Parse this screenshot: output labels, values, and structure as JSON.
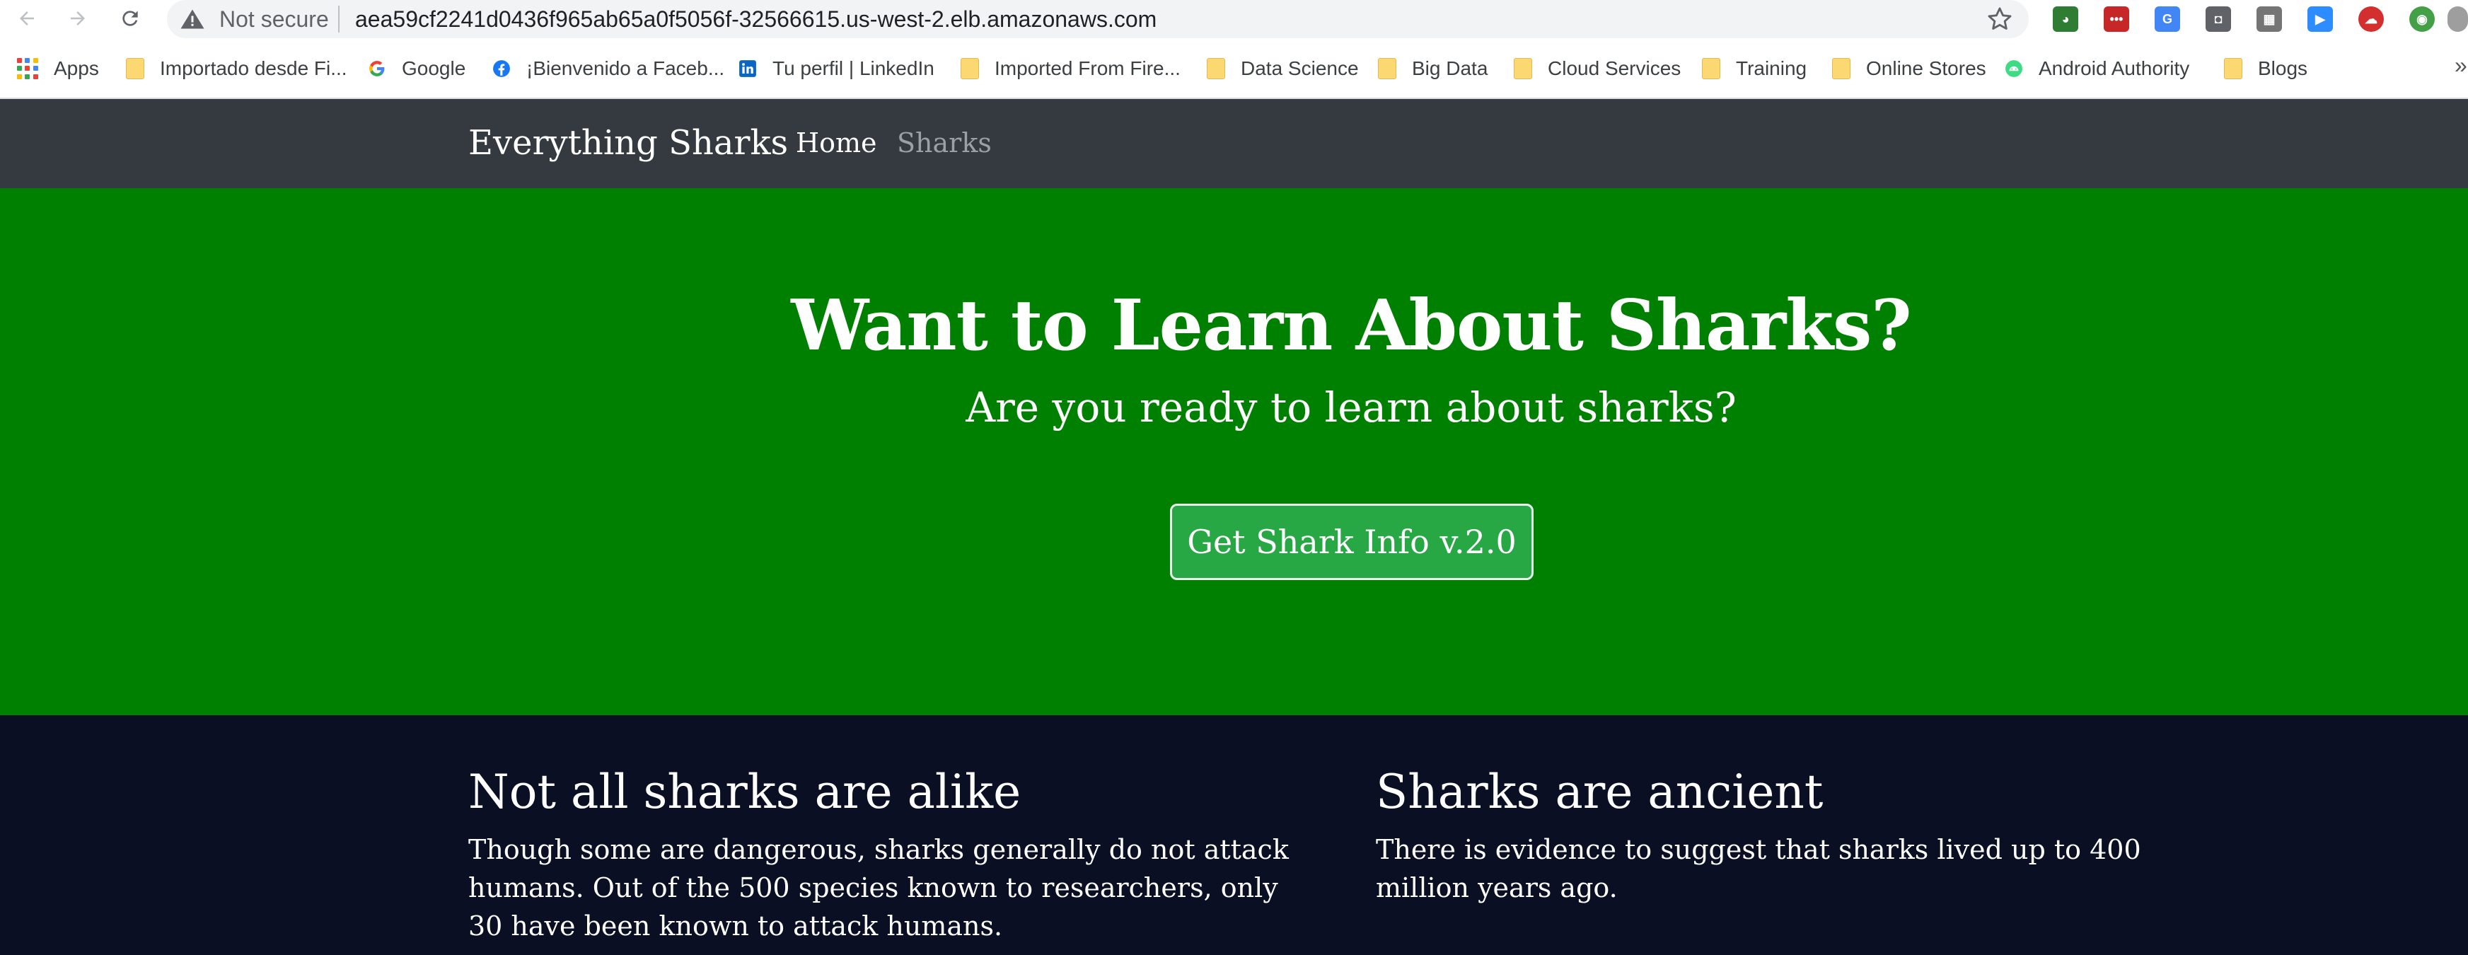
{
  "browser": {
    "security_label": "Not secure",
    "url": "aea59cf2241d0436f965ab65a0f5056f-32566615.us-west-2.elb.amazonaws.com",
    "extensions": [
      "globe-extension-icon",
      "lastpass-extension-icon",
      "translate-extension-icon",
      "keep-extension-icon",
      "storage-extension-icon",
      "zoom-extension-icon",
      "cloud-extension-icon",
      "grammar-extension-icon"
    ]
  },
  "bookmarks": {
    "items": [
      {
        "label": "Apps",
        "icon": "apps-grid-icon"
      },
      {
        "label": "Importado desde Fi...",
        "icon": "folder-icon"
      },
      {
        "label": "Google",
        "icon": "google-icon"
      },
      {
        "label": "¡Bienvenido a Faceb...",
        "icon": "facebook-icon"
      },
      {
        "label": "Tu perfil | LinkedIn",
        "icon": "linkedin-icon"
      },
      {
        "label": "Imported From Fire...",
        "icon": "folder-icon"
      },
      {
        "label": "Data Science",
        "icon": "folder-icon"
      },
      {
        "label": "Big Data",
        "icon": "folder-icon"
      },
      {
        "label": "Cloud Services",
        "icon": "folder-icon"
      },
      {
        "label": "Training",
        "icon": "folder-icon"
      },
      {
        "label": "Online Stores",
        "icon": "folder-icon"
      },
      {
        "label": "Android Authority",
        "icon": "android-icon"
      },
      {
        "label": "Blogs",
        "icon": "folder-icon"
      }
    ],
    "more": "»"
  },
  "site_nav": {
    "brand": "Everything Sharks",
    "home": "Home",
    "sharks": "Sharks"
  },
  "hero": {
    "title": "Want to Learn About Sharks?",
    "subtitle": "Are you ready to learn about sharks?",
    "button": "Get Shark Info v.2.0",
    "background": "#008000"
  },
  "content": {
    "left": {
      "title": "Not all sharks are alike",
      "text": "Though some are dangerous, sharks generally do not attack humans. Out of the 500 species known to researchers, only 30 have been known to attack humans."
    },
    "right": {
      "title": "Sharks are ancient",
      "text": "There is evidence to suggest that sharks lived up to 400 million years ago."
    }
  }
}
